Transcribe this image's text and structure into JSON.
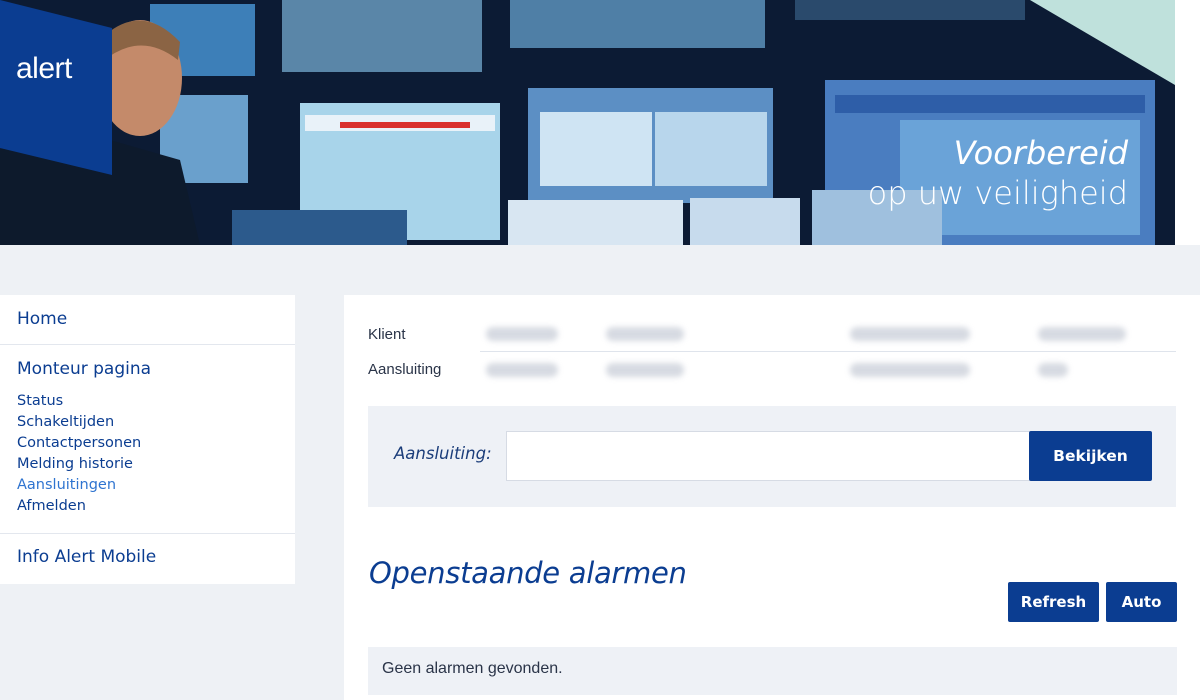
{
  "brand": {
    "logo_text": "alert",
    "accent": "#0b3d91",
    "link_active": "#2f74d0"
  },
  "banner": {
    "slogan_line1": "Voorbereid",
    "slogan_line2": "op uw veiligheid"
  },
  "sidebar": {
    "home": "Home",
    "monteur": {
      "heading": "Monteur pagina",
      "items": [
        {
          "label": "Status",
          "active": false
        },
        {
          "label": "Schakeltijden",
          "active": false
        },
        {
          "label": "Contactpersonen",
          "active": false
        },
        {
          "label": "Melding historie",
          "active": false
        },
        {
          "label": "Aansluitingen",
          "active": true
        },
        {
          "label": "Afmelden",
          "active": false
        }
      ]
    },
    "mobile": "Info Alert Mobile"
  },
  "info": {
    "client_label": "Klient",
    "connection_label": "Aansluiting"
  },
  "search": {
    "label": "Aansluiting:",
    "value": "",
    "placeholder": "",
    "button": "Bekijken"
  },
  "alarms": {
    "title": "Openstaande alarmen",
    "refresh_button": "Refresh",
    "auto_button": "Auto",
    "empty_message": "Geen alarmen gevonden."
  }
}
